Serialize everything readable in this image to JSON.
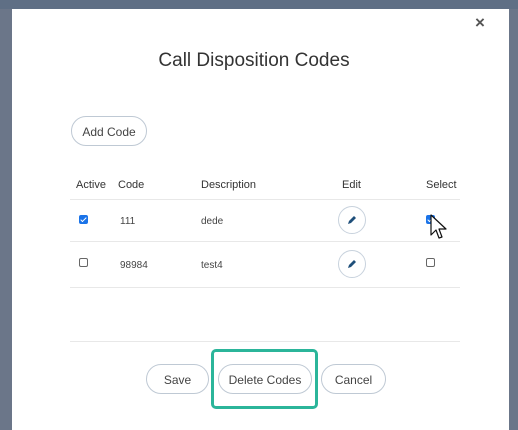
{
  "dialog": {
    "title": "Call Disposition Codes",
    "close_glyph": "×"
  },
  "toolbar": {
    "add_code_label": "Add Code"
  },
  "table": {
    "headers": {
      "active": "Active",
      "code": "Code",
      "description": "Description",
      "edit": "Edit",
      "select": "Select"
    },
    "rows": [
      {
        "active": true,
        "code": "111",
        "description": "dede",
        "selected": true
      },
      {
        "active": false,
        "code": "98984",
        "description": "test4",
        "selected": false
      }
    ]
  },
  "footer": {
    "save_label": "Save",
    "delete_label": "Delete Codes",
    "cancel_label": "Cancel"
  },
  "colors": {
    "checkbox_checked": "#1a73e8",
    "highlight_border": "#2bb59a",
    "backdrop": "#6b7689"
  },
  "icons": {
    "edit": "pencil-icon",
    "close": "close-icon",
    "cursor": "mouse-pointer-icon"
  }
}
